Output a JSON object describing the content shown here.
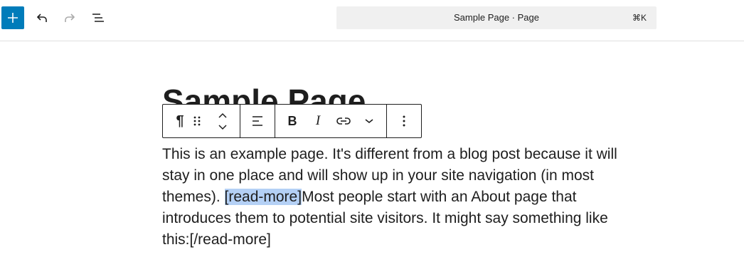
{
  "header": {
    "document_title": "Sample Page · Page",
    "shortcut": "⌘K",
    "add_icon": "plus-icon",
    "undo_icon": "undo-icon",
    "redo_icon": "redo-icon",
    "list_view_icon": "list-view-icon",
    "accent_color": "#007cba"
  },
  "editor": {
    "title": "Sample Page",
    "paragraph_before": "This is an example page. It's different from a blog post because it will stay in one place and will show up in your site navigation (in most themes). ",
    "selected_text": "[read-more]",
    "paragraph_after": "Most people start with an About page that introduces them to potential site visitors. It might say something like this:[/read-more]",
    "selection_color": "#b4d0f5"
  },
  "block_toolbar": {
    "icons": [
      "paragraph-icon",
      "drag-handle-icon",
      "move-up-icon",
      "move-down-icon",
      "align-icon",
      "bold-icon",
      "italic-icon",
      "link-icon",
      "more-formats-icon",
      "options-icon"
    ],
    "bold_label": "B",
    "italic_label": "I",
    "paragraph_label": "¶"
  }
}
